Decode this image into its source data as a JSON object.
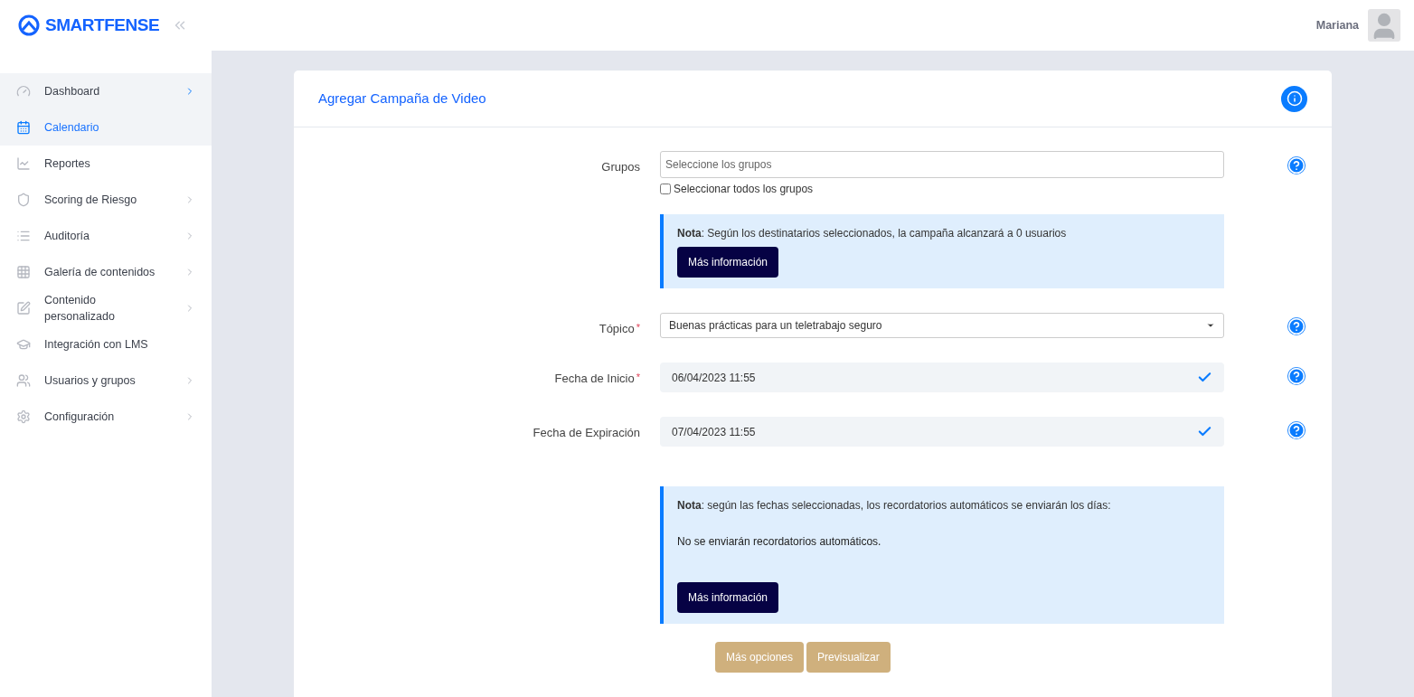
{
  "logo": {
    "text": "SMARTFENSE"
  },
  "sidebar": {
    "items": [
      {
        "label": "Dashboard",
        "chevron": true,
        "selected": false,
        "highlighted": true
      },
      {
        "label": "Calendario",
        "chevron": false,
        "selected": true,
        "highlighted": true
      },
      {
        "label": "Reportes",
        "chevron": false,
        "selected": false,
        "highlighted": false
      },
      {
        "label": "Scoring de Riesgo",
        "chevron": true,
        "selected": false,
        "highlighted": false
      },
      {
        "label": "Auditoría",
        "chevron": true,
        "selected": false,
        "highlighted": false
      },
      {
        "label": "Galería de contenidos",
        "chevron": true,
        "selected": false,
        "highlighted": false
      },
      {
        "label": "Contenido personalizado",
        "chevron": true,
        "selected": false,
        "highlighted": false
      },
      {
        "label": "Integración con LMS",
        "chevron": false,
        "selected": false,
        "highlighted": false
      },
      {
        "label": "Usuarios y grupos",
        "chevron": true,
        "selected": false,
        "highlighted": false
      },
      {
        "label": "Configuración",
        "chevron": true,
        "selected": false,
        "highlighted": false
      }
    ]
  },
  "header": {
    "user_name": "Mariana"
  },
  "card": {
    "title": "Agregar Campaña de Video",
    "groups": {
      "label": "Grupos",
      "placeholder": "Seleccione los grupos",
      "select_all": {
        "label": "Seleccionar todos los grupos",
        "checked": false
      }
    },
    "note_1": {
      "text": "**Nota**: Según los destinatarios seleccionados, la campaña alcanzará a 0 usuarios",
      "button": "Más información"
    },
    "fields": [
      {
        "kind": "select",
        "label": "Tópico",
        "required_mark": "*",
        "value": "Buenas prácticas para un teletrabajo seguro"
      },
      {
        "kind": "date",
        "label": "Fecha de Inicio",
        "required_mark": "*",
        "value": "06/04/2023 11:55"
      },
      {
        "kind": "date",
        "label": "Fecha de Expiración",
        "value": "07/04/2023 11:55"
      }
    ],
    "note_2": {
      "text": "**Nota**: según las fechas seleccionadas, los recordatorios automáticos se enviarán los días:",
      "detail": "No se enviarán recordatorios automáticos.",
      "button": "Más información"
    },
    "buttons": [
      "Más opciones",
      "Previsualizar"
    ]
  }
}
